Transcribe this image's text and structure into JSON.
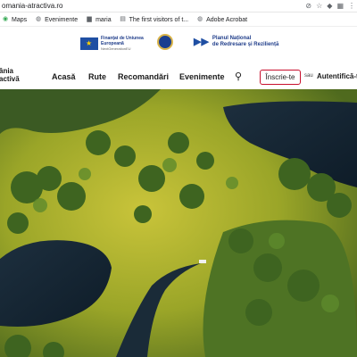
{
  "browser": {
    "url": "omania-atractiva.ro",
    "bookmarks": [
      {
        "label": "Maps",
        "icon": "maps-icon"
      },
      {
        "label": "Evenimente",
        "icon": "globe-icon"
      },
      {
        "label": "maria",
        "icon": "folder-icon"
      },
      {
        "label": "The first visitors of t...",
        "icon": "page-icon"
      },
      {
        "label": "Adobe Acrobat",
        "icon": "globe-icon"
      }
    ]
  },
  "funding": {
    "eu_title": "Finanțat de Uniunea Europeană",
    "eu_subtitle": "NextGenerationEU",
    "pnrr_line1": "Planul Național",
    "pnrr_line2": "de Redresare și Reziliență"
  },
  "header": {
    "logo_line1": "ânia",
    "logo_line2": "activă",
    "nav": {
      "acasa": "Acasă",
      "rute": "Rute",
      "recomandari": "Recomandări",
      "evenimente": "Evenimente"
    },
    "signup": "Înscrie-te",
    "or": "sau",
    "login": "Autentifică-t"
  },
  "hero": {
    "description_icon": "aerial-delta-landscape"
  }
}
